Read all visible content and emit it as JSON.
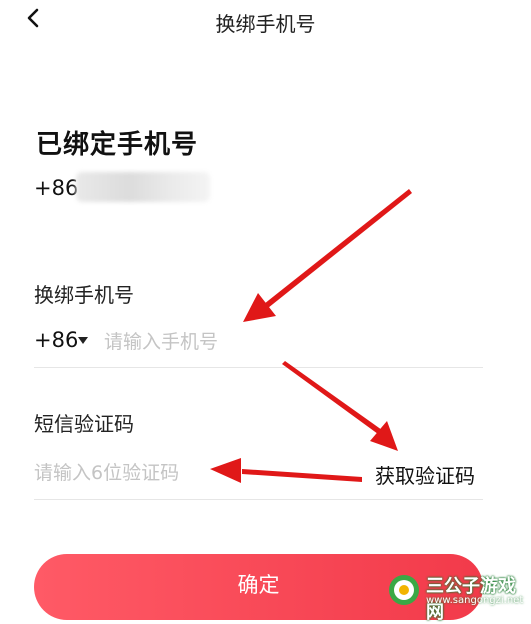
{
  "header": {
    "title": "换绑手机号",
    "back_icon": "chevron-left-icon"
  },
  "bound": {
    "title": "已绑定手机号",
    "prefix": "+86 1"
  },
  "rebind": {
    "label": "换绑手机号",
    "country_code": "+86",
    "phone_placeholder": "请输入手机号"
  },
  "sms": {
    "label": "短信验证码",
    "code_placeholder": "请输入6位验证码",
    "get_code_label": "获取验证码"
  },
  "confirm_label": "确定",
  "watermark": {
    "name": "三公子游戏网",
    "url": "www.sangongzi.net"
  },
  "colors": {
    "accent": "#f23a4a",
    "arrow": "#e01818",
    "placeholder": "#c4c4c4"
  }
}
